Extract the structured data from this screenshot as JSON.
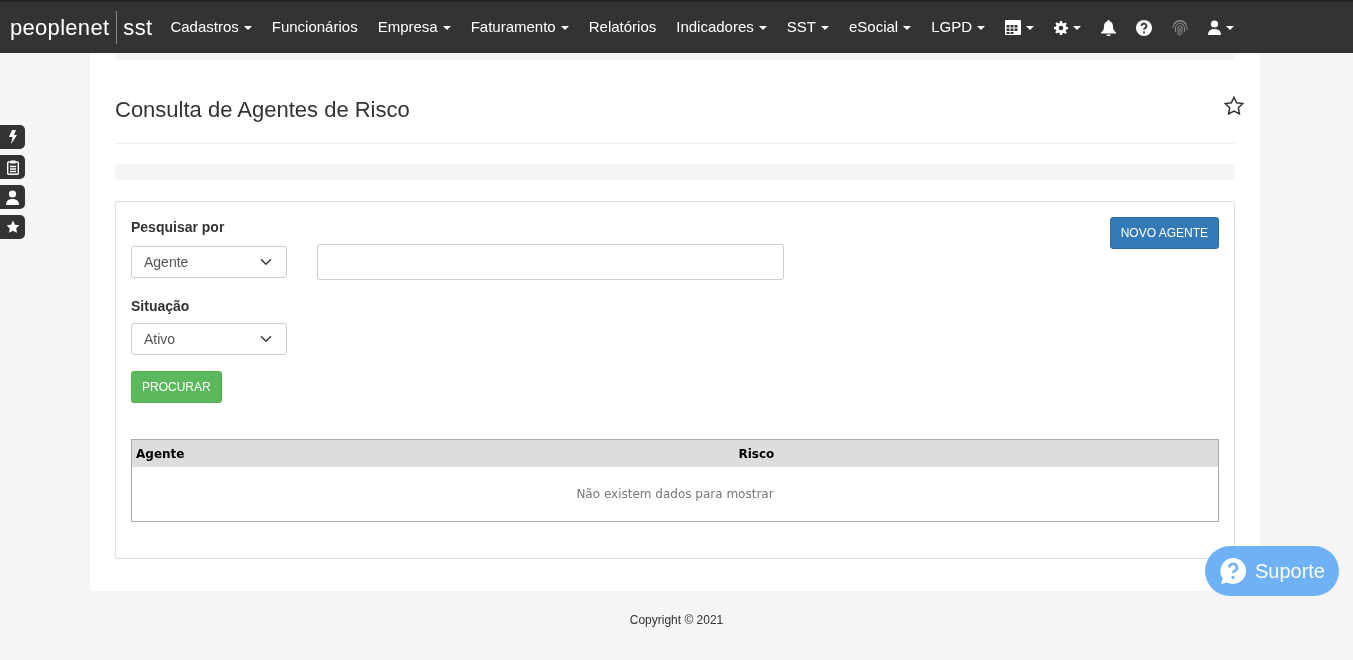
{
  "navbar": {
    "brand": "peoplenet",
    "brand_suffix": "sst",
    "menu": [
      {
        "label": "Cadastros",
        "dropdown": true
      },
      {
        "label": "Funcionários",
        "dropdown": false
      },
      {
        "label": "Empresa",
        "dropdown": true
      },
      {
        "label": "Faturamento",
        "dropdown": true
      },
      {
        "label": "Relatórios",
        "dropdown": false
      },
      {
        "label": "Indicadores",
        "dropdown": true
      },
      {
        "label": "SST",
        "dropdown": true
      },
      {
        "label": "eSocial",
        "dropdown": true
      },
      {
        "label": "LGPD",
        "dropdown": true
      }
    ],
    "icon_menu": [
      {
        "kind": "calendar",
        "dropdown": true
      },
      {
        "kind": "gear",
        "dropdown": true
      },
      {
        "kind": "bell",
        "dropdown": false
      },
      {
        "kind": "help",
        "dropdown": false
      },
      {
        "kind": "fingerprint",
        "dropdown": false
      },
      {
        "kind": "user",
        "dropdown": true
      }
    ]
  },
  "side_shortcuts": [
    {
      "kind": "bolt"
    },
    {
      "kind": "clipboard"
    },
    {
      "kind": "user"
    },
    {
      "kind": "star"
    }
  ],
  "page": {
    "title": "Consulta de Agentes de Risco",
    "favorite": false
  },
  "search": {
    "label": "Pesquisar por",
    "field_select": "Agente",
    "status_label": "Situação",
    "status_select": "Ativo",
    "search_button": "PROCURAR",
    "new_button": "NOVO AGENTE"
  },
  "table": {
    "columns": [
      "Agente",
      "Risco"
    ],
    "empty_message": "Não existem dados para mostrar"
  },
  "footer": "Copyright © 2021",
  "support_button": "Suporte"
}
